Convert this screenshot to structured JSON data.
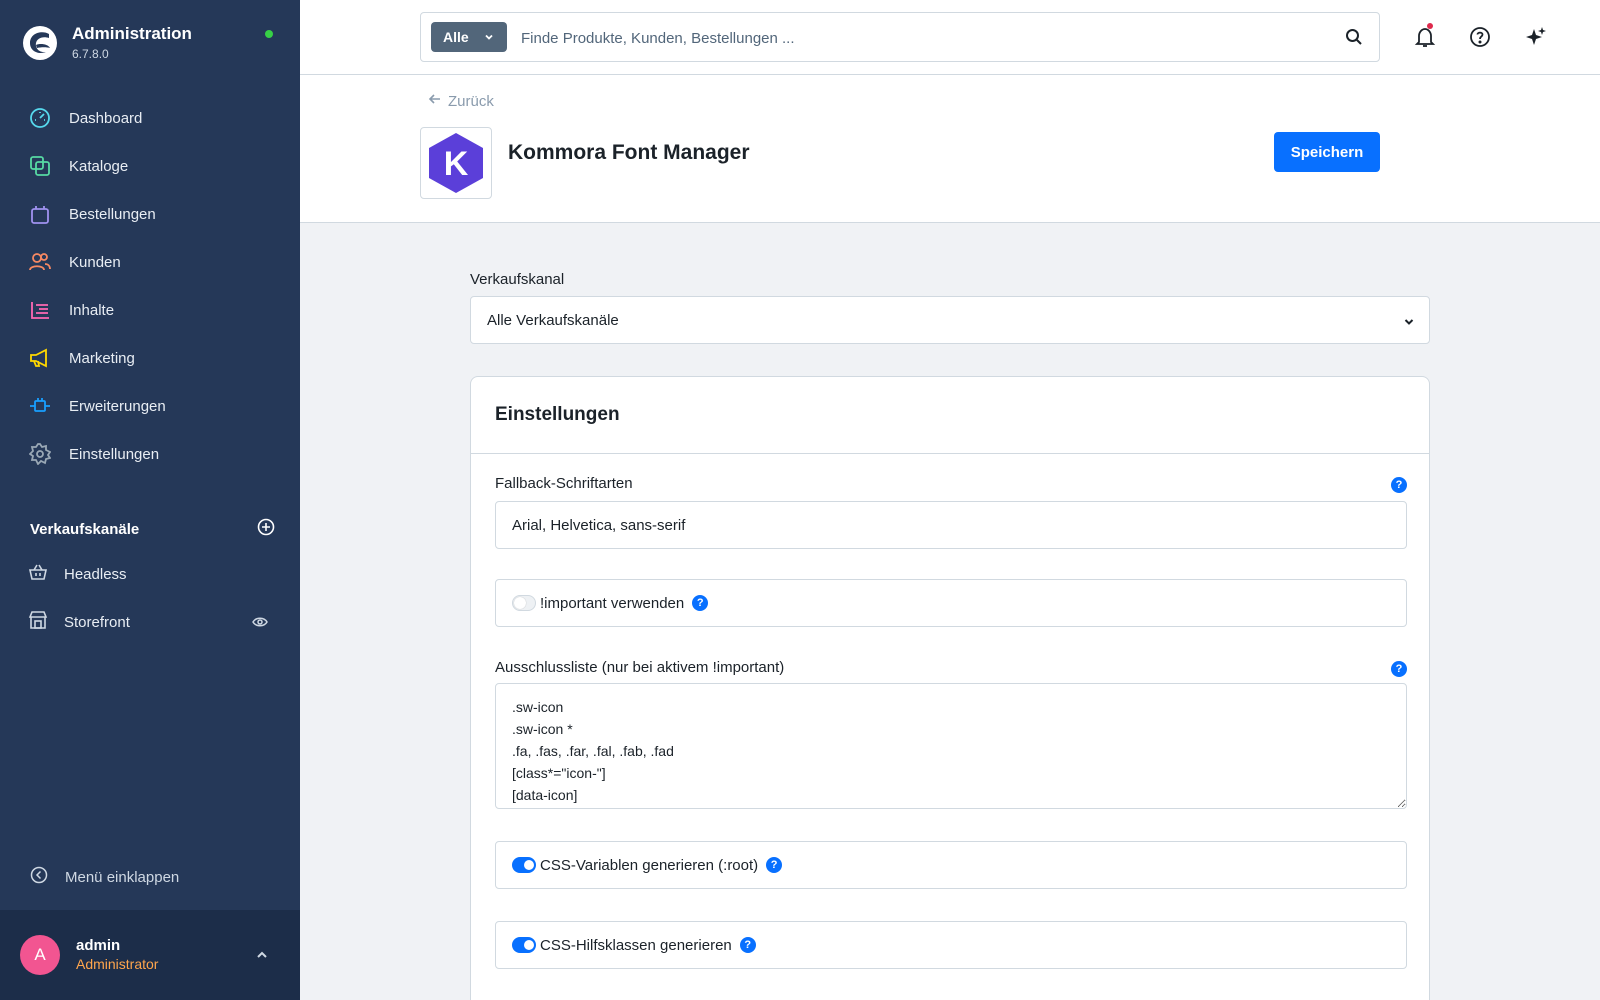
{
  "app": {
    "title": "Administration",
    "version": "6.7.8.0",
    "status_color": "#37d046"
  },
  "nav": {
    "items": [
      {
        "label": "Dashboard",
        "icon": "dashboard-icon",
        "color": "#57d9ed"
      },
      {
        "label": "Kataloge",
        "icon": "catalog-icon",
        "color": "#57d9a3"
      },
      {
        "label": "Bestellungen",
        "icon": "bag-icon",
        "color": "#a092f0"
      },
      {
        "label": "Kunden",
        "icon": "customers-icon",
        "color": "#f88962"
      },
      {
        "label": "Inhalte",
        "icon": "content-icon",
        "color": "#ff68b4"
      },
      {
        "label": "Marketing",
        "icon": "megaphone-icon",
        "color": "#ffd700"
      },
      {
        "label": "Erweiterungen",
        "icon": "plug-icon",
        "color": "#189eff"
      },
      {
        "label": "Einstellungen",
        "icon": "gear-icon",
        "color": "#9aa8b5"
      }
    ]
  },
  "sales_channels": {
    "title": "Verkaufskanäle",
    "items": [
      {
        "label": "Headless",
        "icon": "basket-icon"
      },
      {
        "label": "Storefront",
        "icon": "storefront-icon"
      }
    ]
  },
  "collapse_label": "Menü einklappen",
  "user": {
    "initial": "A",
    "name": "admin",
    "role": "Administrator"
  },
  "search": {
    "type": "Alle",
    "placeholder": "Finde Produkte, Kunden, Bestellungen ..."
  },
  "header": {
    "back": "Zurück",
    "title": "Kommora Font Manager",
    "save": "Speichern",
    "logo_letter": "K",
    "logo_color": "#5b3fd9"
  },
  "sales_channel_select": {
    "label": "Verkaufskanal",
    "value": "Alle Verkaufskanäle"
  },
  "settings": {
    "title": "Einstellungen",
    "fallback_label": "Fallback-Schriftarten",
    "fallback_value": "Arial, Helvetica, sans-serif",
    "important_label": "!important verwenden",
    "important_on": false,
    "exclusion_label": "Ausschlussliste (nur bei aktivem !important)",
    "exclusion_value": ".sw-icon\n.sw-icon *\n.fa, .fas, .far, .fal, .fab, .fad\n[class*=\"icon-\"]\n[data-icon]",
    "css_vars_label": "CSS-Variablen generieren (:root)",
    "css_vars_on": true,
    "helper_classes_label": "CSS-Hilfsklassen generieren",
    "helper_classes_on": true,
    "help_glyph": "?"
  }
}
